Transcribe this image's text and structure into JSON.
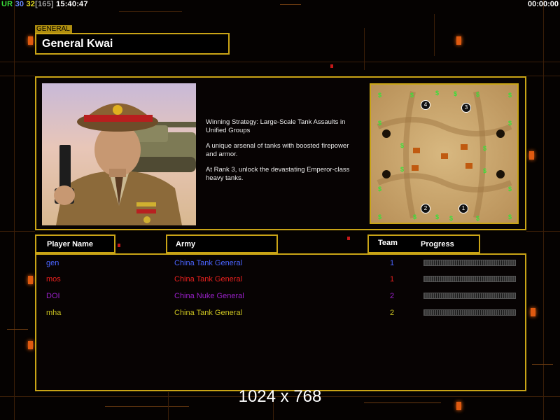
{
  "status": {
    "ur_label": "UR",
    "fps": "30",
    "frame": "32",
    "frame_detail": "[165]",
    "clock": "15:40:47",
    "timer": "00:00:00"
  },
  "general": {
    "tag": "GENERAL",
    "name": "General Kwai",
    "description": [
      "Winning Strategy: Large-Scale Tank Assaults in\n Unified Groups",
      "A unique arsenal of tanks with boosted firepower\n and armor.",
      "At Rank 3, unlock the devastating Emperor-class\n heavy tanks."
    ]
  },
  "map": {
    "start_positions": [
      "4",
      "3",
      "2",
      "1"
    ],
    "supply_icon": "$"
  },
  "table": {
    "headers": {
      "player_name": "Player Name",
      "army": "Army",
      "team": "Team",
      "progress": "Progress"
    },
    "rows": [
      {
        "name": "gen",
        "army": "China Tank General",
        "team": "1",
        "color": "#4a64ff"
      },
      {
        "name": "mos",
        "army": "China Tank General",
        "team": "1",
        "color": "#e8201e"
      },
      {
        "name": "DOI",
        "army": "China Nuke General",
        "team": "2",
        "color": "#9820c8"
      },
      {
        "name": "mha",
        "army": "China Tank General",
        "team": "2",
        "color": "#c8c020"
      }
    ]
  },
  "resolution": "1024 x 768",
  "colors": {
    "frame_gold": "#c9a416",
    "accent_orange": "#e05a10"
  }
}
